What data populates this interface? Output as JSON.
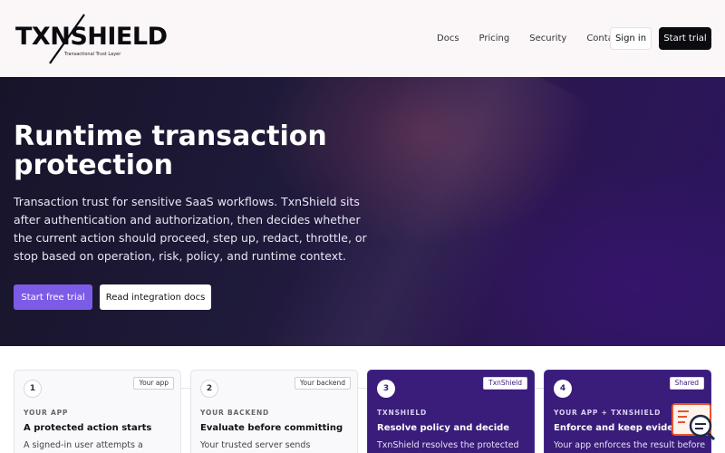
{
  "brand": {
    "name": "TXNSHIELD",
    "tagline": "Transactional Trust Layer"
  },
  "nav": {
    "items": [
      "Docs",
      "Pricing",
      "Security",
      "Contact"
    ],
    "sign_in": "Sign in",
    "start_trial": "Start trial"
  },
  "hero": {
    "title": "Runtime transaction protection",
    "description": "Transaction trust for sensitive SaaS workflows. TxnShield sits after authentication and authorization, then decides whether the current action should proceed, step up, redact, throttle, or stop based on operation, risk, policy, and runtime context.",
    "primary_cta": "Start free trial",
    "secondary_cta": "Read integration docs"
  },
  "steps": [
    {
      "number": "1",
      "badge": "Your app",
      "kicker": "YOUR APP",
      "title": "A protected action starts",
      "body": "A signed-in user attempts a concrete",
      "theme": "light"
    },
    {
      "number": "2",
      "badge": "Your backend",
      "kicker": "YOUR BACKEND",
      "title": "Evaluate before committing",
      "body": "Your trusted server sends",
      "theme": "light"
    },
    {
      "number": "3",
      "badge": "TxnShield",
      "kicker": "TXNSHIELD",
      "title": "Resolve policy and decide",
      "body": "TxnShield resolves the protected",
      "theme": "dark"
    },
    {
      "number": "4",
      "badge": "Shared",
      "kicker": "YOUR APP + TXNSHIELD",
      "title": "Enforce and keep evidence",
      "body": "Your app enforces the result before",
      "theme": "dark"
    }
  ],
  "colors": {
    "accent": "#7c5ce6",
    "dark_card": "#3a1c7a",
    "header_bg": "#fbf7f9",
    "widget": "#e8542d"
  },
  "icons": {
    "chat_widget": "support-chat-icon"
  }
}
